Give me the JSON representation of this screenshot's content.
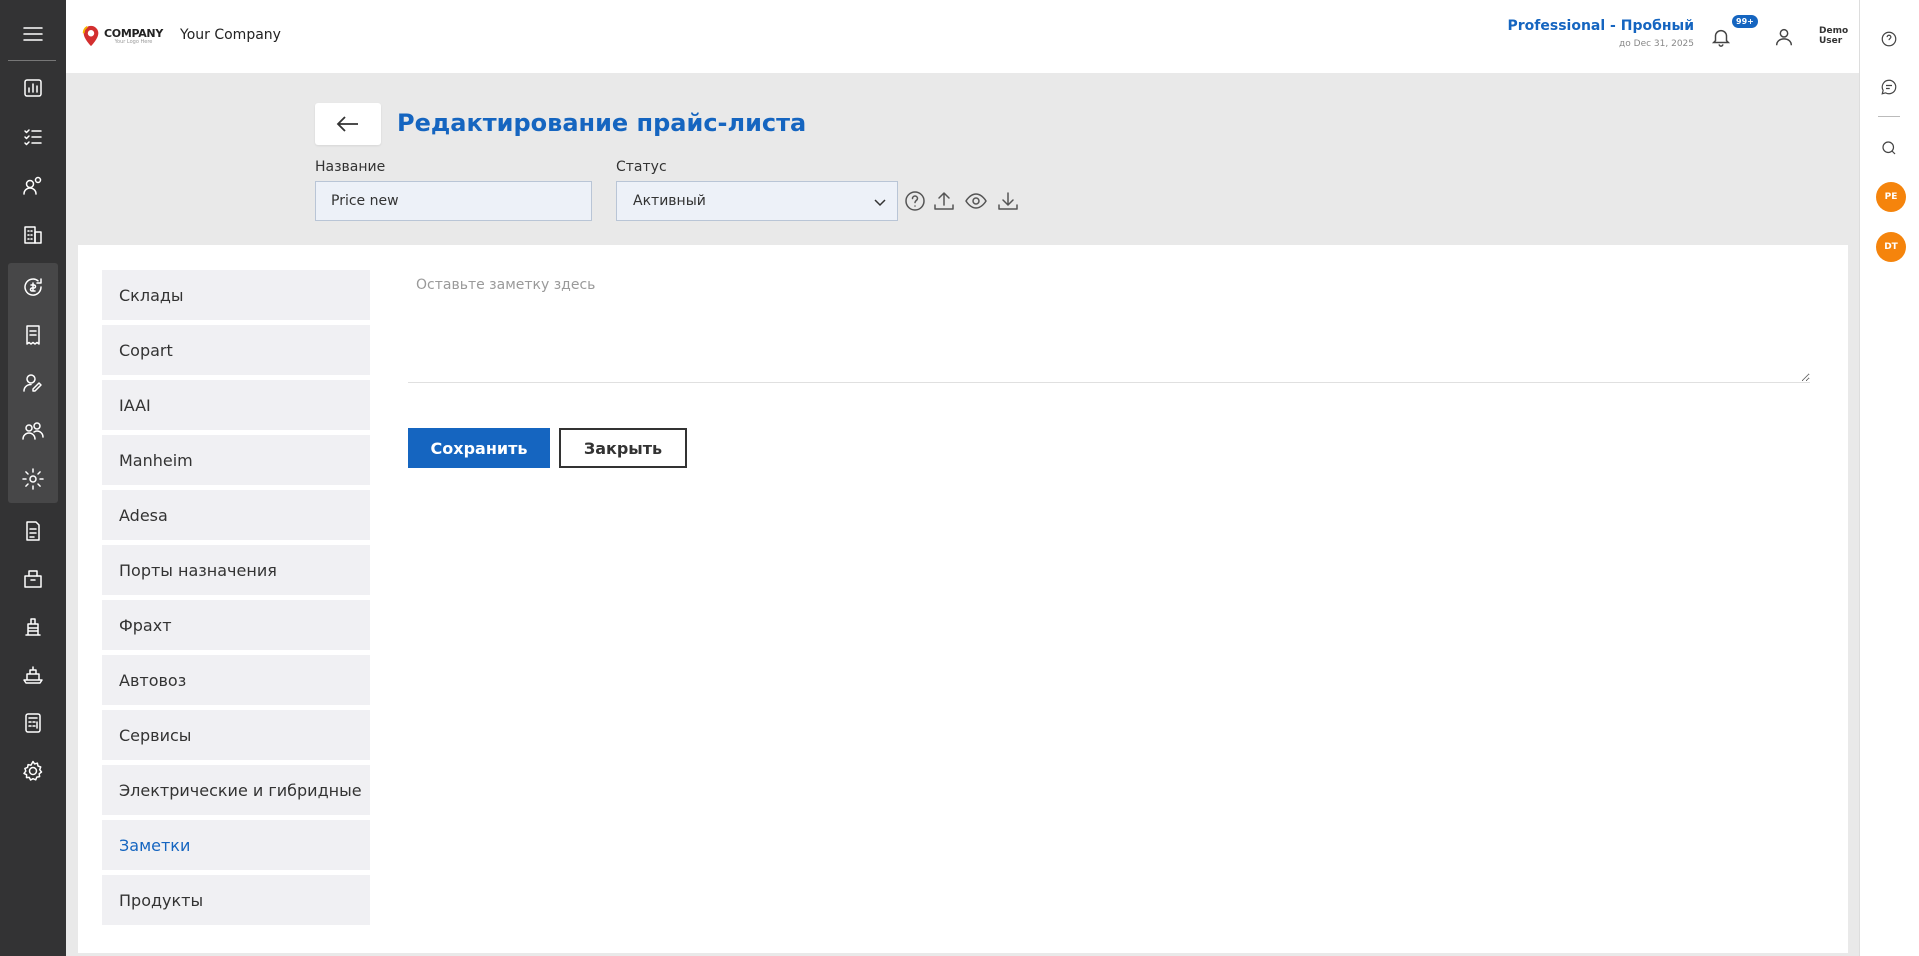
{
  "app": {
    "logo_text": "COMPANY",
    "logo_subtext": "Your Logo Here",
    "company_name": "Your Company"
  },
  "header": {
    "plan_name": "Professional - Пробный",
    "plan_expiry": "до Dec 31, 2025",
    "notifications_badge": "99+",
    "user_first": "Demo",
    "user_last": "User"
  },
  "sidebar_icons": [
    "menu-icon",
    "dashboard-icon",
    "checklist-icon",
    "users-icon",
    "building-icon",
    "exchange-icon",
    "receipt-icon",
    "user-edit-icon",
    "team-icon",
    "settings-cog-icon",
    "document-icon",
    "package-icon",
    "crane-icon",
    "ship-icon",
    "calculator-icon",
    "gear-icon"
  ],
  "right_bar": {
    "avatars": [
      "PE",
      "DT"
    ]
  },
  "page": {
    "title": "Редактирование прайс-листа",
    "name_label": "Название",
    "name_value": "Price new",
    "status_label": "Статус",
    "status_value": "Активный"
  },
  "nav": {
    "items": [
      "Склады",
      "Copart",
      "IAAI",
      "Manheim",
      "Adesa",
      "Порты назначения",
      "Фрахт",
      "Автовоз",
      "Сервисы",
      "Электрические и гибридные",
      "Заметки",
      "Продукты"
    ],
    "active_index": 10
  },
  "notes": {
    "placeholder": "Оставьте заметку здесь",
    "value": ""
  },
  "actions": {
    "save_label": "Сохранить",
    "close_label": "Закрыть"
  },
  "colors": {
    "accent": "#1565c0",
    "sidebar_bg": "#333334",
    "avatar": "#f5840c"
  }
}
